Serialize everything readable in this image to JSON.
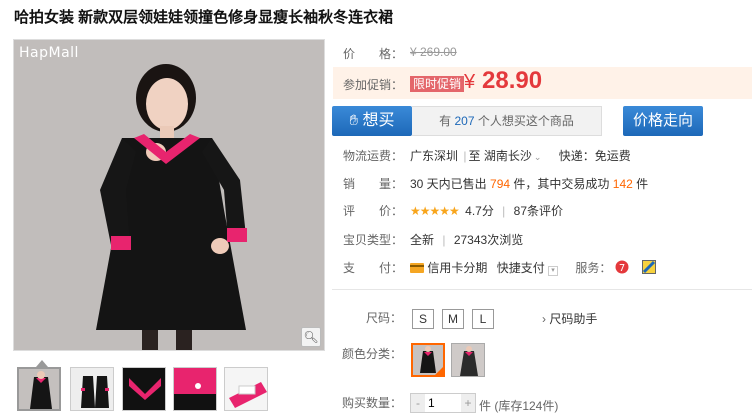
{
  "title": "哈拍女装 新款双层领娃娃领撞色修身显瘦长袖秋冬连衣裙",
  "gallery": {
    "logo_text": "HapMall",
    "zoom_icon": "magnifier-icon"
  },
  "price": {
    "label": "价　　格：",
    "original": "¥ 269.00"
  },
  "promo": {
    "label": "参加促销：",
    "badge": "限时促销",
    "currency": "¥",
    "price": "28.90"
  },
  "want": {
    "button_label": "想买",
    "prefix": "有",
    "count": "207",
    "suffix": "个人想买这个商品"
  },
  "price_trend_label": "价格走向",
  "shipping": {
    "label": "物流运费：",
    "from": "广东深圳",
    "sep": "|",
    "to_prefix": "至",
    "to": "湖南长沙",
    "method": "快递：免运费"
  },
  "sales": {
    "label": "销　　量：",
    "prefix": "30 天内已售出",
    "sold": "794",
    "mid": "件，其中交易成功",
    "success": "142",
    "suffix": "件"
  },
  "rating": {
    "label": "评　　价：",
    "stars": "★★★★★",
    "score": "4.7分",
    "sep": "|",
    "count": "87条评价"
  },
  "type": {
    "label": "宝贝类型：",
    "condition": "全新",
    "sep": "|",
    "views": "27343次浏览"
  },
  "payment": {
    "label": "支　　付：",
    "credit": "信用卡分期",
    "quick": "快捷支付",
    "service_label": "服务："
  },
  "size": {
    "label": "尺码：",
    "options": [
      "S",
      "M",
      "L"
    ],
    "helper": "尺码助手"
  },
  "color": {
    "label": "颜色分类："
  },
  "quantity": {
    "label": "购买数量：",
    "value": "1",
    "minus": "-",
    "plus": "+",
    "stock": "件 (库存124件)"
  },
  "colors": {
    "accent": "#e4393c",
    "button_blue": "#1d68b8",
    "orange": "#ff6600"
  }
}
